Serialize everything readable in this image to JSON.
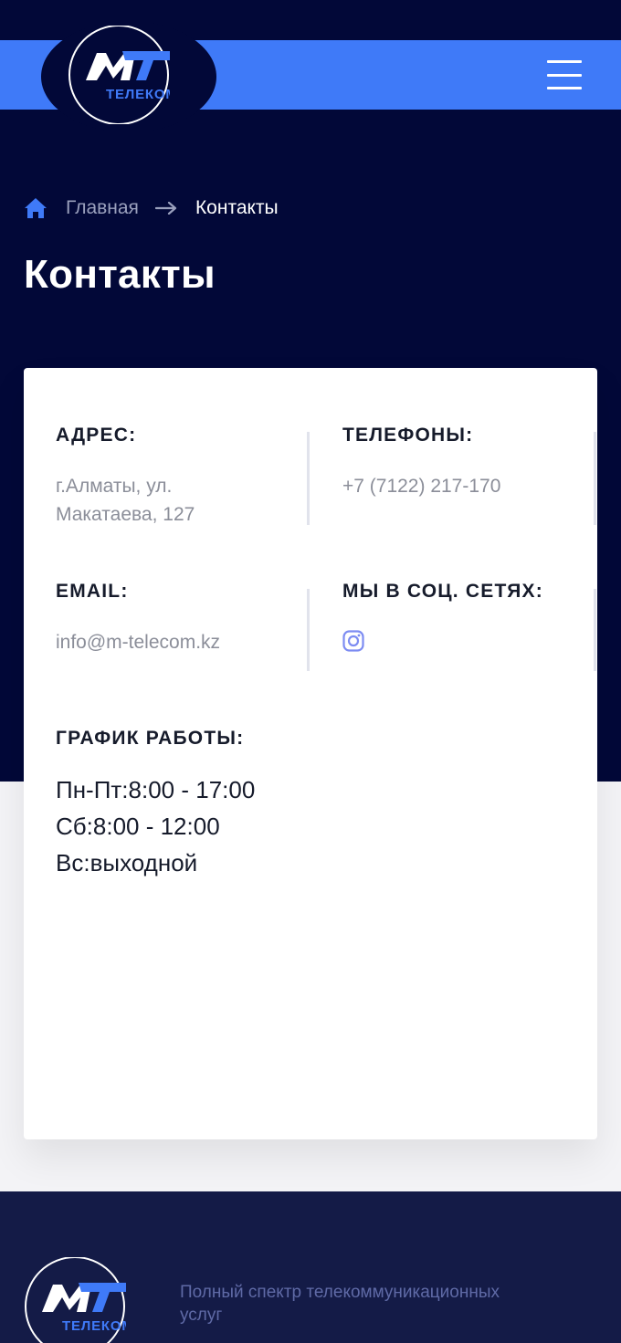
{
  "brand": {
    "logo_mark": "MT",
    "logo_sub": "ТЕЛЕКОМ",
    "colors": {
      "navy": "#020838",
      "blue": "#3f7af8",
      "footer": "#141b47"
    }
  },
  "header": {
    "menu_icon": "hamburger-menu-icon"
  },
  "breadcrumb": {
    "home_icon": "home-icon",
    "home_label": "Главная",
    "separator_icon": "arrow-right-icon",
    "current_label": "Контакты"
  },
  "page": {
    "title": "Контакты"
  },
  "contacts": {
    "address": {
      "label": "АДРЕС:",
      "line1": "г.Алматы, ул.",
      "line2": "Макатаева, 127"
    },
    "phones": {
      "label": "ТЕЛЕФОНЫ:",
      "value": "+7 (7122) 217-170"
    },
    "email": {
      "label": "EMAIL:",
      "value": "info@m-telecom.kz"
    },
    "social": {
      "label": "МЫ В СОЦ. СЕТЯХ:",
      "icons": [
        "instagram-icon"
      ]
    },
    "schedule": {
      "label": "ГРАФИК РАБОТЫ:",
      "rows": [
        "Пн-Пт:8:00 - 17:00",
        "Сб:8:00 - 12:00",
        "Вс:выходной"
      ]
    }
  },
  "footer": {
    "tagline_line1": "Полный спектр телекоммуникационных",
    "tagline_line2": "услуг"
  }
}
